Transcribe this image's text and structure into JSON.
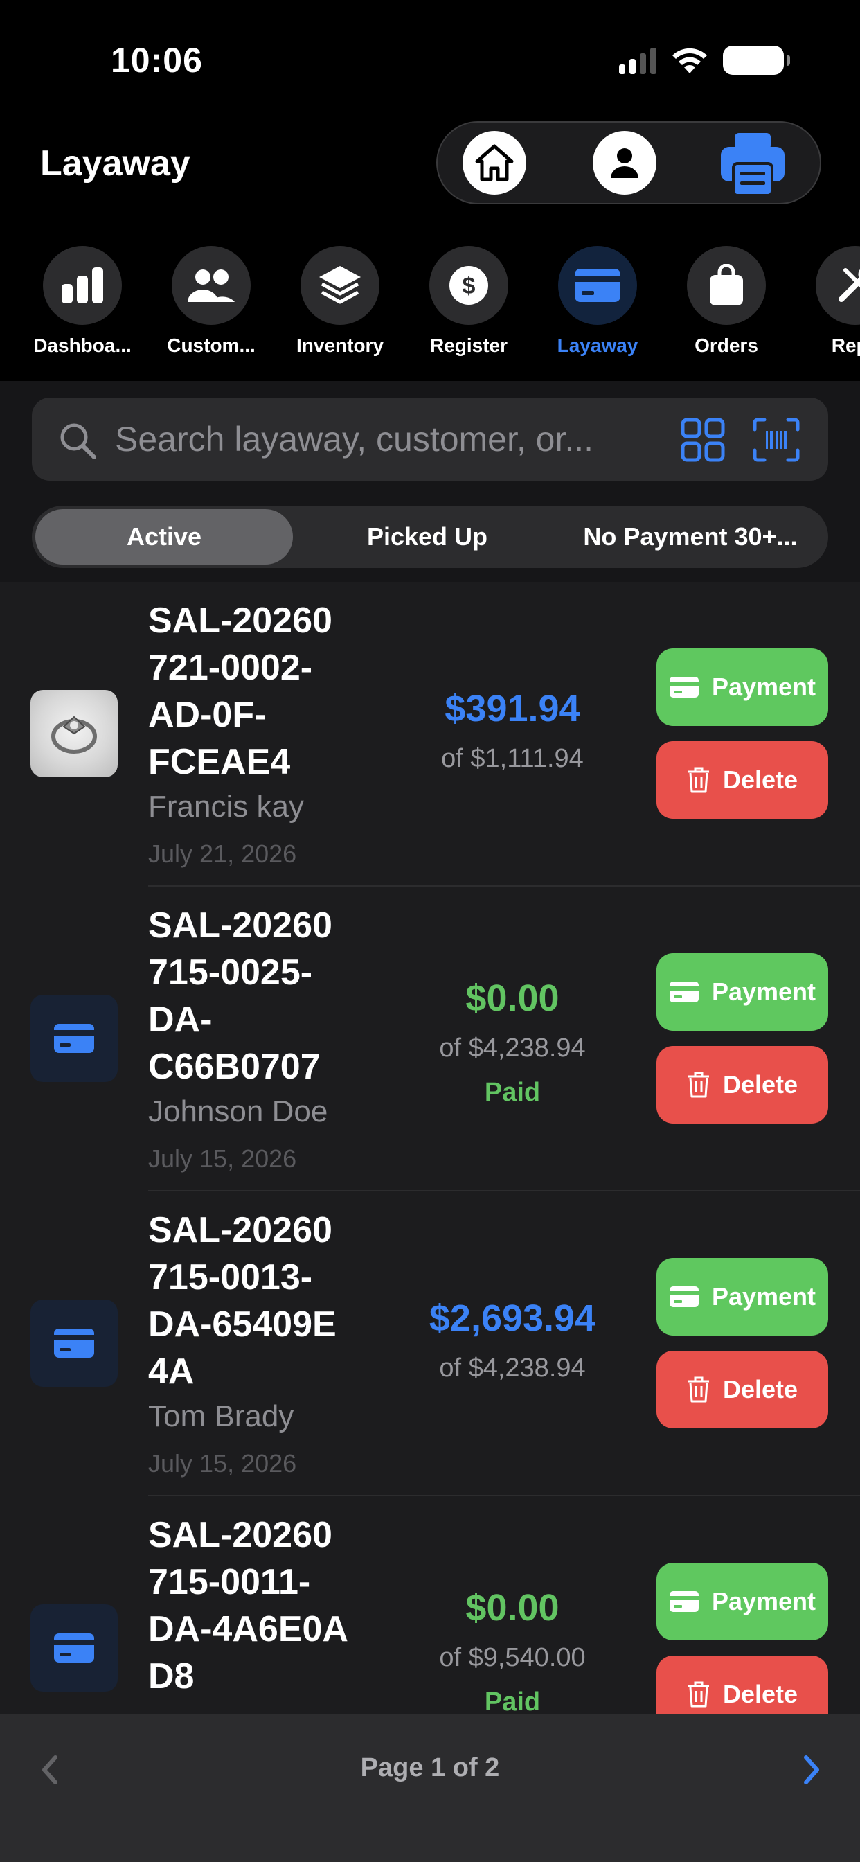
{
  "status": {
    "time": "10:06"
  },
  "header": {
    "title": "Layaway"
  },
  "nav": [
    {
      "label": "Dashboa...",
      "icon": "chart-bars-icon"
    },
    {
      "label": "Custom...",
      "icon": "people-icon"
    },
    {
      "label": "Inventory",
      "icon": "layers-icon"
    },
    {
      "label": "Register",
      "icon": "dollar-icon"
    },
    {
      "label": "Layaway",
      "icon": "card-icon",
      "active": true
    },
    {
      "label": "Orders",
      "icon": "bag-icon"
    },
    {
      "label": "Repa",
      "icon": "tools-icon"
    }
  ],
  "search": {
    "placeholder": "Search layaway, customer, or..."
  },
  "segments": [
    {
      "label": "Active",
      "active": true
    },
    {
      "label": "Picked Up"
    },
    {
      "label": "No Payment 30+..."
    }
  ],
  "layaways": [
    {
      "sale_id": "SAL-20260 721-0002- AD-0F- FCEAE4",
      "customer": "Francis kay",
      "date": "July 21, 2026",
      "amount": "$391.94",
      "amount_color": "blue",
      "total": "of $1,111.94",
      "status": "",
      "thumb": "photo"
    },
    {
      "sale_id": "SAL-20260 715-0025- DA- C66B0707",
      "customer": "Johnson Doe",
      "date": "July 15, 2026",
      "amount": "$0.00",
      "amount_color": "green",
      "total": "of $4,238.94",
      "status": "Paid",
      "thumb": "card"
    },
    {
      "sale_id": "SAL-20260 715-0013- DA-65409E 4A",
      "customer": "Tom Brady",
      "date": "July 15, 2026",
      "amount": "$2,693.94",
      "amount_color": "blue",
      "total": "of $4,238.94",
      "status": "",
      "thumb": "card"
    },
    {
      "sale_id": "SAL-20260 715-0011- DA-4A6E0A D8",
      "customer": "",
      "date": "",
      "amount": "$0.00",
      "amount_color": "green",
      "total": "of $9,540.00",
      "status": "Paid",
      "thumb": "card"
    }
  ],
  "buttons": {
    "payment": "Payment",
    "delete": "Delete"
  },
  "pagination": {
    "label": "Page 1 of 2"
  },
  "colors": {
    "accent": "#3b82f6",
    "success": "#5fc85f",
    "danger": "#e8504b"
  }
}
